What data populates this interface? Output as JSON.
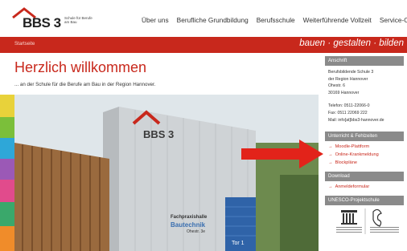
{
  "header": {
    "logo_text": "BBS 3",
    "logo_sub": "Schule für Berufe am Bau",
    "nav": [
      "Über uns",
      "Berufliche Grundbildung",
      "Berufsschule",
      "Weiterführende Vollzeit",
      "Service-Center"
    ]
  },
  "band": {
    "breadcrumb": "Startseite",
    "tagline": "bauen · gestalten · bilden"
  },
  "main": {
    "title": "Herzlich willkommen",
    "intro": "... an der Schule für die Berufe am Bau in der Region Hannover.",
    "photo_sign_1": "BBS 3",
    "photo_sign_2": "Fachpraxishalle",
    "photo_sign_3": "Bautechnik",
    "photo_sign_4": "Ohestr. 3e",
    "photo_door": "Tor 1"
  },
  "sidebar": {
    "address_head": "Anschrift",
    "address_lines": [
      "Berufsbildende Schule 3",
      "der Region Hannover",
      "Ohestr. 6",
      "30169 Hannover"
    ],
    "phone": "Telefon: 0511-22066-0",
    "fax": "Fax: 0511 22069 222",
    "mail": "Mail: info[at]bbs3-hannover.de",
    "teaching_head": "Unterricht & Fehlzeiten",
    "teaching_links": [
      "Moodle-Plattform",
      "Online-Krankmeldung",
      "Blockpläne"
    ],
    "download_head": "Download",
    "download_links": [
      "Anmeldeformular"
    ],
    "unesco_head": "UNESCO-Projektschule"
  },
  "colors": {
    "accent": "#c8281c",
    "sidebar_head": "#8a8a8a"
  }
}
